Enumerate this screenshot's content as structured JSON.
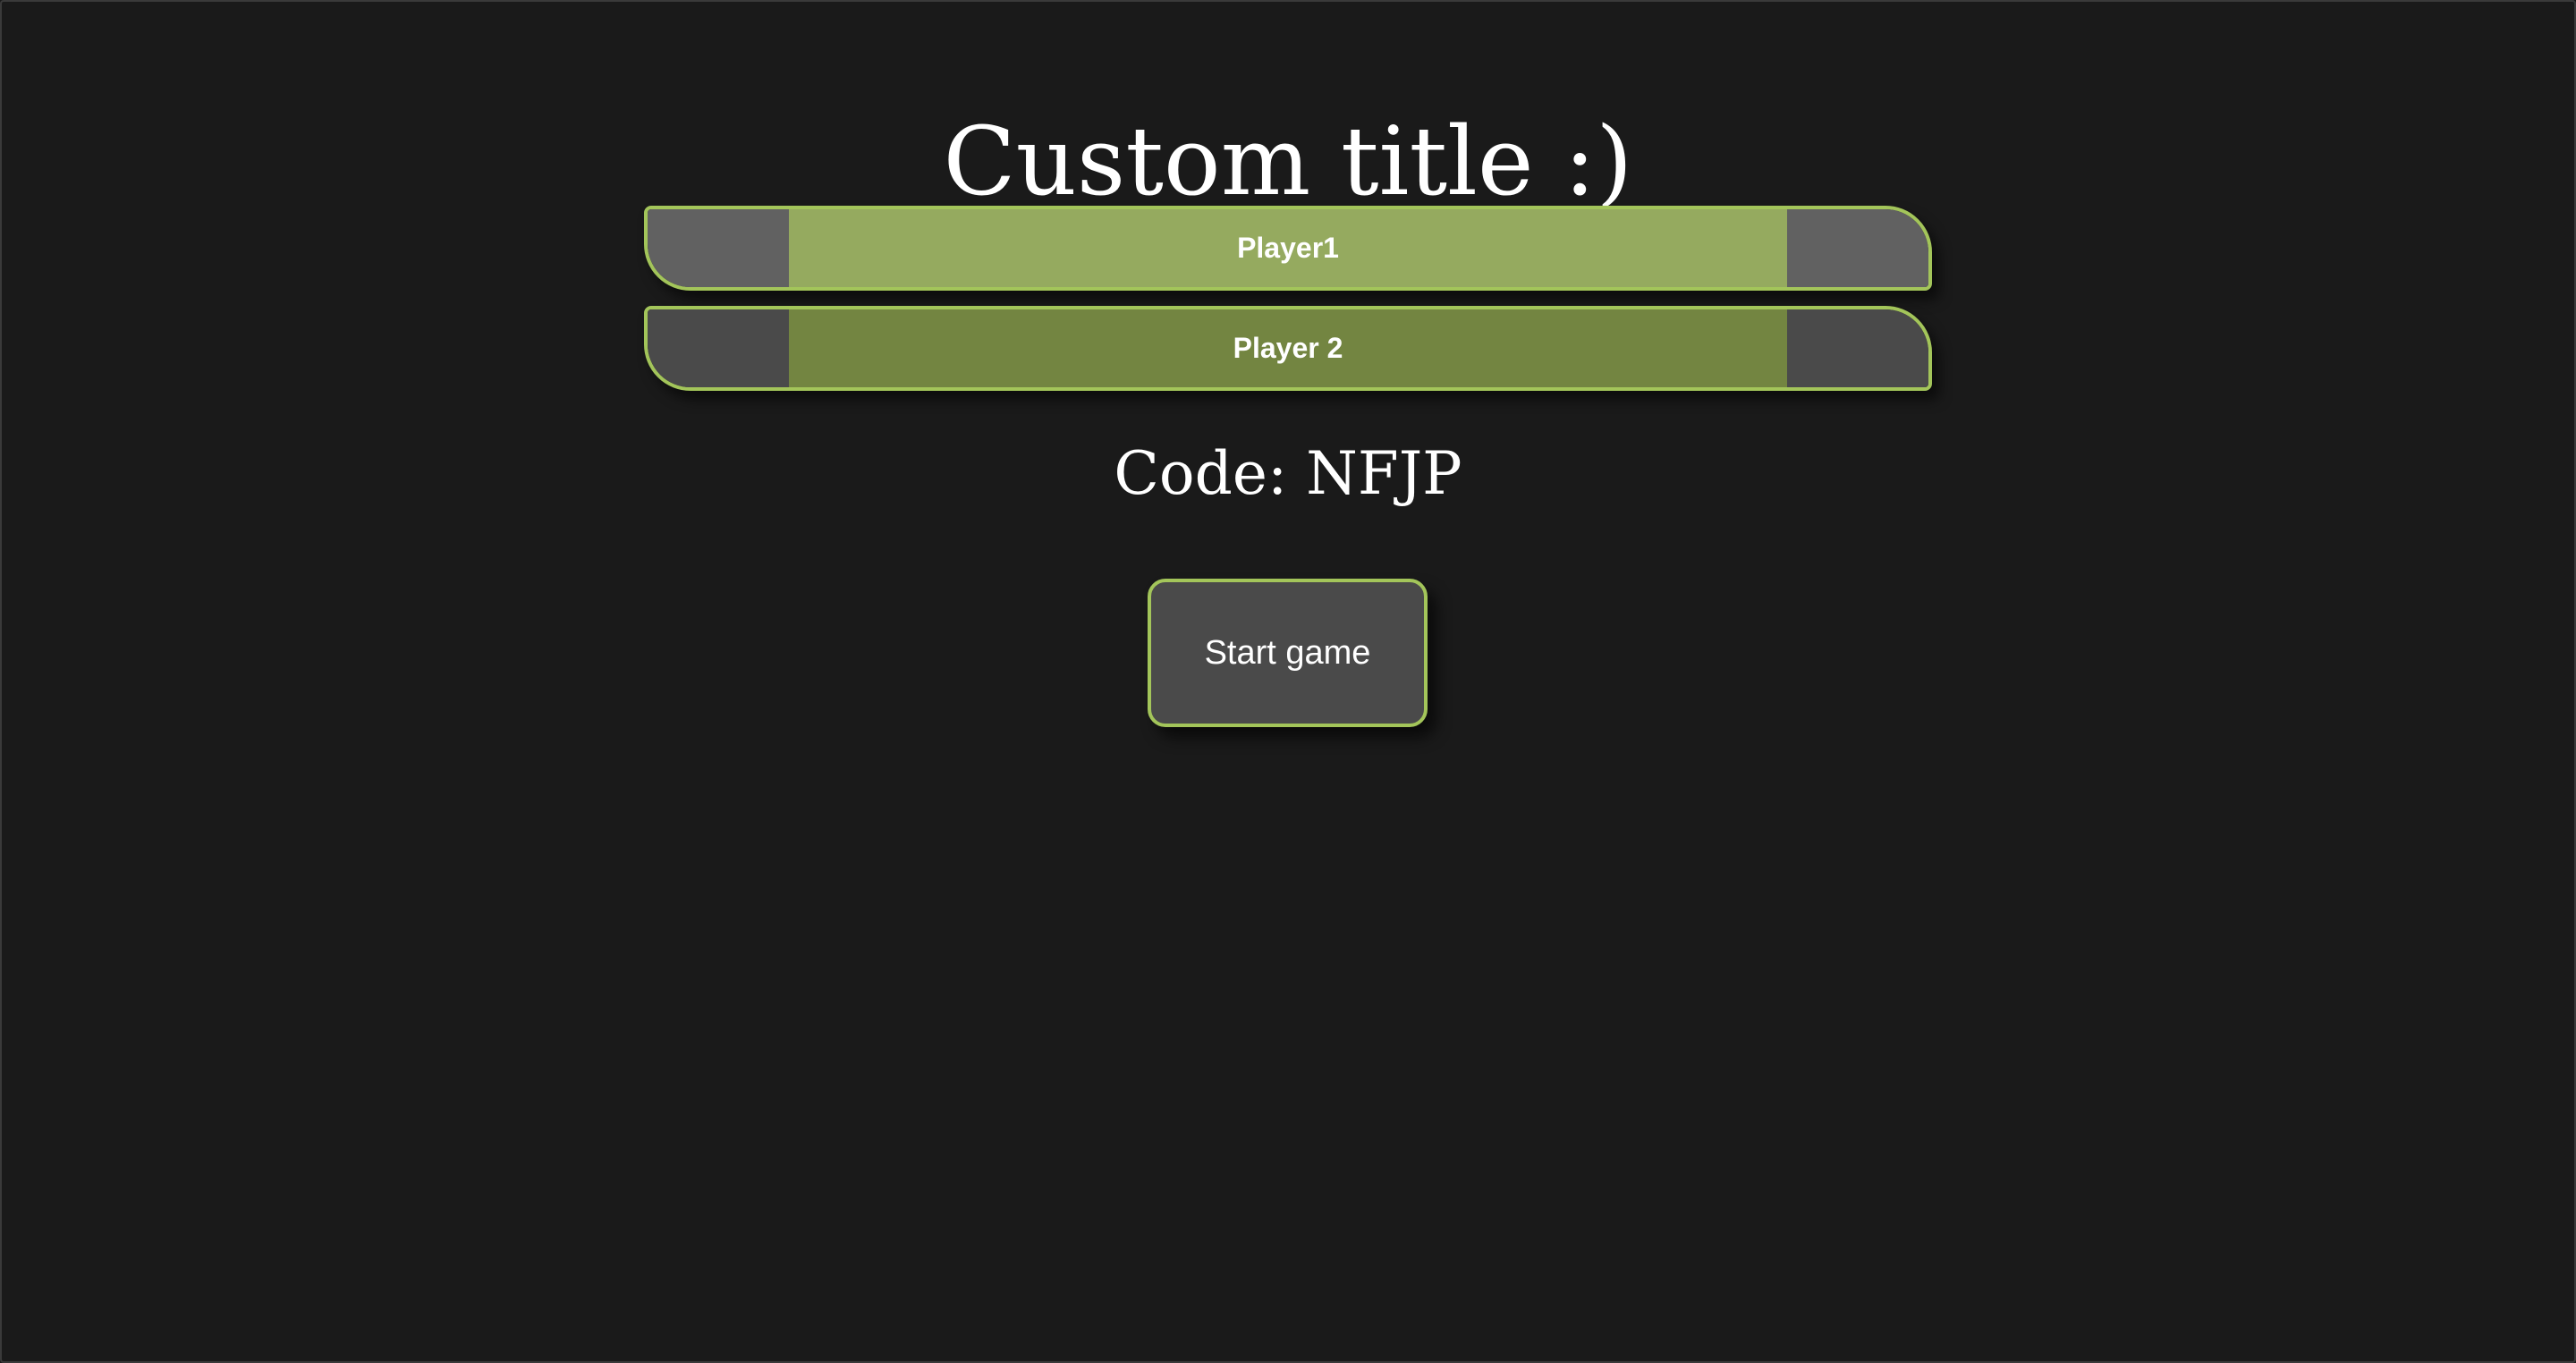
{
  "title": "Custom title :)",
  "players": [
    {
      "name": "Player1"
    },
    {
      "name": "Player 2"
    }
  ],
  "code_label": "Code: NFJP",
  "start_button": {
    "label": "Start game"
  },
  "colors": {
    "background": "#1a1a1a",
    "accent_border": "#a3c55a",
    "player1_fill": "#95aa5f",
    "player2_fill": "#738541",
    "button_fill": "#4a4a4a"
  }
}
